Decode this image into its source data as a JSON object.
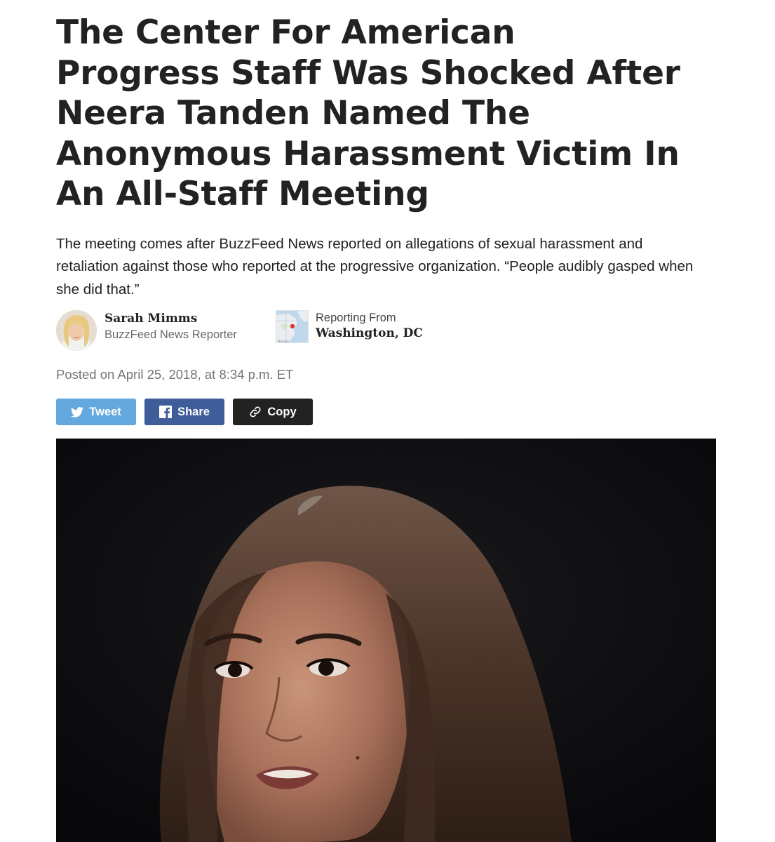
{
  "article": {
    "headline": "The Center For American Progress Staff Was Shocked After Neera Tanden Named The Anonymous Harassment Victim In An All-Staff Meeting",
    "dek": "The meeting comes after BuzzFeed News reported on allegations of sexual harassment and retaliation against those who reported at the progressive organization. “People audibly gasped when she did that.”",
    "author": {
      "name": "Sarah Mimms",
      "role": "BuzzFeed News Reporter"
    },
    "location": {
      "label": "Reporting From",
      "value": "Washington, DC"
    },
    "timestamp": "Posted on April 25, 2018, at 8:34 p.m. ET"
  },
  "share": {
    "tweet_label": "Tweet",
    "share_label": "Share",
    "copy_label": "Copy",
    "colors": {
      "twitter": "#64a8e0",
      "facebook": "#3f5d9a",
      "copy": "#222222"
    }
  },
  "icons": {
    "tweet": "twitter-bird-icon",
    "share": "facebook-f-icon",
    "copy": "link-icon"
  }
}
